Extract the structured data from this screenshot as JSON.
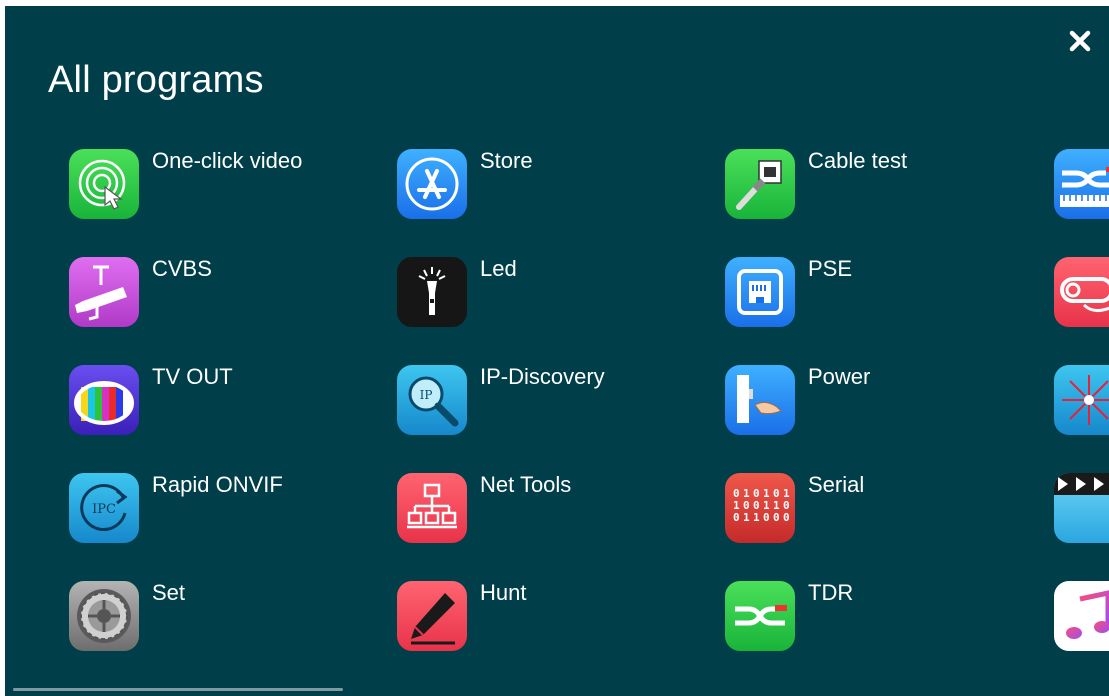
{
  "screen": {
    "title": "All programs",
    "close_icon": "close-icon",
    "background_color": "#003e4a"
  },
  "apps": {
    "one_click_video": {
      "label": "One-click video",
      "icon": "touch-target-icon",
      "color": "#2ecc40"
    },
    "store": {
      "label": "Store",
      "icon": "app-store-icon",
      "color": "#1e90ff"
    },
    "cable_test": {
      "label": "Cable test",
      "icon": "ethernet-cable-icon",
      "color": "#2ecc40"
    },
    "cvbs": {
      "label": "CVBS",
      "icon": "cctv-camera-icon",
      "color": "#c34fd8"
    },
    "led": {
      "label": "Led",
      "icon": "flashlight-icon",
      "color": "#111111"
    },
    "pse": {
      "label": "PSE",
      "icon": "ethernet-port-icon",
      "color": "#1e90ff"
    },
    "tv_out": {
      "label": "TV OUT",
      "icon": "color-bars-icon",
      "color": "#4b2fd0"
    },
    "ip_discovery": {
      "label": "IP-Discovery",
      "icon": "ip-magnifier-icon",
      "color": "#1aa3e0"
    },
    "power": {
      "label": "Power",
      "icon": "power-socket-icon",
      "color": "#1e90ff"
    },
    "rapid_onvif": {
      "label": "Rapid ONVIF",
      "icon": "ipc-refresh-icon",
      "color": "#1aa3e0"
    },
    "net_tools": {
      "label": "Net Tools",
      "icon": "network-topology-icon",
      "color": "#f04a5a"
    },
    "serial": {
      "label": "Serial",
      "icon": "binary-data-icon",
      "color": "#e3403c"
    },
    "set": {
      "label": "Set",
      "icon": "settings-gear-icon",
      "color": "#8a8a8a"
    },
    "hunt": {
      "label": "Hunt",
      "icon": "pen-icon",
      "color": "#f04a5a"
    },
    "tdr": {
      "label": "TDR",
      "icon": "tdr-signal-icon",
      "color": "#2ecc40"
    },
    "col4_row1": {
      "icon": "tdr-ruler-icon",
      "color": "#1e90ff"
    },
    "col4_row2": {
      "icon": "cable-loop-icon",
      "color": "#f04a5a"
    },
    "col4_row3": {
      "icon": "laser-icon",
      "color": "#1aa3e0"
    },
    "col4_row4": {
      "icon": "clapperboard-icon",
      "color": "#1aa3e0"
    },
    "col4_row5": {
      "icon": "music-note-icon",
      "color": "#ffffff"
    }
  }
}
